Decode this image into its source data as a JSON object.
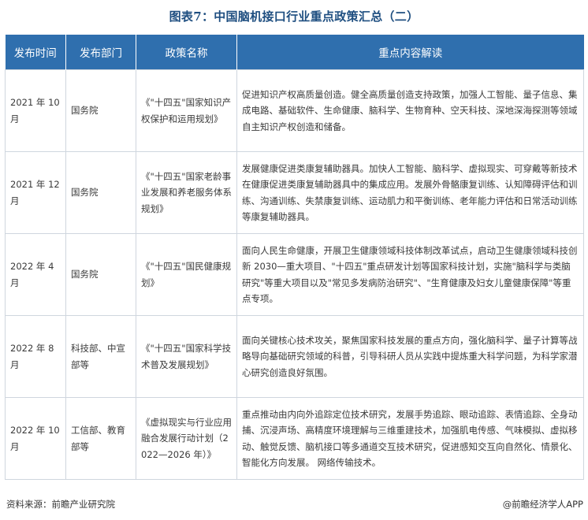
{
  "title": "图表7：中国脑机接口行业重点政策汇总（二）",
  "table": {
    "headers": [
      "发布时间",
      "发布部门",
      "政策名称",
      "重点内容解读"
    ],
    "rows": [
      {
        "date": "2021 年 10 月",
        "dept": "国务院",
        "name": "《\"十四五\"国家知识产权保护和运用规划》",
        "content": "促进知识产权高质量创造。健全高质量创造支持政策，加强人工智能、量子信息、集成电路、基础软件、生命健康、脑科学、生物育种、空天科技、深地深海探测等领域自主知识产权创造和储备。"
      },
      {
        "date": "2021 年 12 月",
        "dept": "国务院",
        "name": "《\"十四五\"国家老龄事业发展和养老服务体系规划》",
        "content": "发展健康促进类康复辅助器具。加快人工智能、脑科学、虚拟现实、可穿戴等新技术在健康促进类康复辅助器具中的集成应用。发展外骨骼康复训练、认知障碍评估和训练、沟通训练、失禁康复训练、运动肌力和平衡训练、老年能力评估和日常活动训练等康复辅助器具。"
      },
      {
        "date": "2022 年 4 月",
        "dept": "国务院",
        "name": "《\"十四五\"国民健康规划》",
        "content": "面向人民生命健康，开展卫生健康领域科技体制改革试点，启动卫生健康领域科技创新 2030—重大项目、\"十四五\"重点研发计划等国家科技计划，实施\"脑科学与类脑研究\"等重大项目以及\"常见多发病防治研究\"、\"生育健康及妇女儿童健康保障\"等重点专项。"
      },
      {
        "date": "2022 年 8 月",
        "dept": "科技部、中宣部等",
        "name": "《\"十四五\"国家科学技术普及发展规划》",
        "content": "面向关键核心技术攻关，聚焦国家科技发展的重点方向，强化脑科学、量子计算等战略导向基础研究领域的科普，引导科研人员从实践中提炼重大科学问题，为科学家潜心研究创造良好氛围。"
      },
      {
        "date": "2022 年 10 月",
        "dept": "工信部、教育部等",
        "name": "《虚拟现实与行业应用融合发展行动计划（2022—2026 年）》",
        "content": "重点推动由内向外追踪定位技术研究，发展手势追踪、眼动追踪、表情追踪、全身动捕、沉浸声场、高精度环境理解与三维重建技术，加强肌电传感、气味模拟、虚拟移动、触觉反馈、脑机接口等多通道交互技术研究，促进感知交互向自然化、情景化、智能化方向发展。 网络传输技术。"
      }
    ]
  },
  "footer": {
    "source": "资料来源：前瞻产业研究院",
    "credit": "@前瞻经济学人APP"
  },
  "colors": {
    "header_bg": "#2f6fae",
    "title": "#1e4e80",
    "border": "#cfd6de"
  }
}
